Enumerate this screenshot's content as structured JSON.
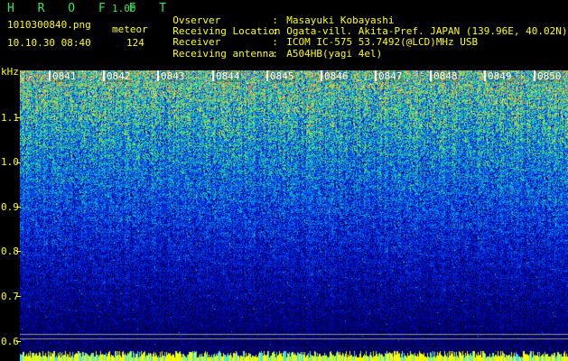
{
  "header": {
    "app_title": "H R O F F T",
    "app_version": "1.00",
    "file_name": "1010300840.png",
    "date_time": "10.10.30 08:40",
    "meteor_label": "meteor",
    "meteor_count": "124"
  },
  "info": [
    {
      "key": "Ovserver",
      "value": "Masayuki Kobayashi"
    },
    {
      "key": "Receiving Location",
      "value": "Ogata-vill. Akita-Pref. JAPAN (139.96E, 40.02N)"
    },
    {
      "key": "Receiver",
      "value": "ICOM IC-575 53.7492(@LCD)MHz USB"
    },
    {
      "key": "Receiving antenna",
      "value": "A504HB(yagi 4el)"
    }
  ],
  "separator": ":",
  "axis": {
    "unit": "kHz",
    "y_ticks": [
      "1.1",
      "1.0",
      "0.9",
      "0.8",
      "0.7",
      "0.6"
    ],
    "time_labels": [
      "0841",
      "0842",
      "0843",
      "0844",
      "0845",
      "0846",
      "0847",
      "0848",
      "0849",
      "0850"
    ]
  },
  "colors": {
    "text_yellow": "#ffff00",
    "title_green": "#2ee85a",
    "background": "#000000"
  }
}
